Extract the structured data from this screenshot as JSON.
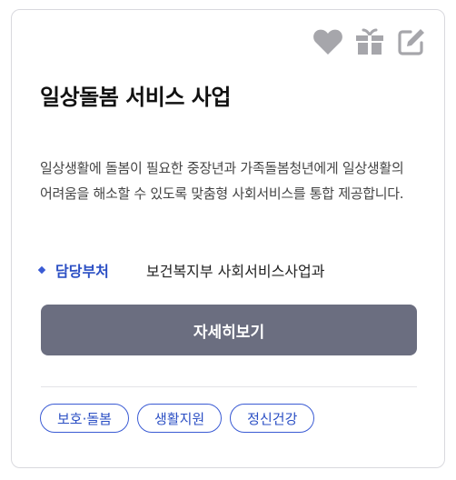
{
  "card": {
    "title": "일상돌봄 서비스 사업",
    "description": "일상생활에 돌봄이 필요한 중장년과 가족돌봄청년에게 일상생활의 어려움을 해소할 수 있도록 맞춤형 사회서비스를 통합 제공합니다.",
    "department": {
      "label": "담당부처",
      "value": "보건복지부 사회서비스사업과"
    },
    "detail_button": "자세히보기",
    "tags": [
      "보호·돌봄",
      "생활지원",
      "정신건강"
    ]
  },
  "actions": {
    "icons": [
      "heart-icon",
      "gift-icon",
      "edit-icon"
    ],
    "icon_color": "#a6a6ab"
  },
  "colors": {
    "accent": "#3a5bd4",
    "button_bg": "#6b6e80",
    "border": "#d9d9de"
  }
}
